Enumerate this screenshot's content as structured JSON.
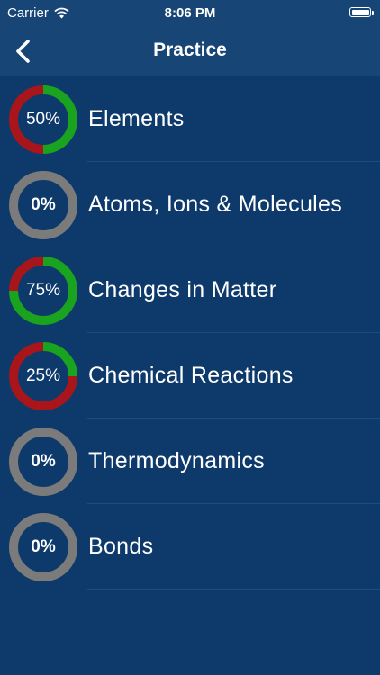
{
  "status_bar": {
    "carrier": "Carrier",
    "time": "8:06 PM"
  },
  "nav": {
    "title": "Practice"
  },
  "colors": {
    "correct": "#1aa31e",
    "incorrect": "#a8161b",
    "empty": "#7b7b7b"
  },
  "topics": [
    {
      "name": "Elements",
      "percent_label": "50%",
      "correct_fraction": 0.5
    },
    {
      "name": "Atoms, Ions & Molecules",
      "percent_label": "0%",
      "correct_fraction": 0
    },
    {
      "name": "Changes in Matter",
      "percent_label": "75%",
      "correct_fraction": 0.75
    },
    {
      "name": "Chemical Reactions",
      "percent_label": "25%",
      "correct_fraction": 0.25
    },
    {
      "name": "Thermodynamics",
      "percent_label": "0%",
      "correct_fraction": 0
    },
    {
      "name": "Bonds",
      "percent_label": "0%",
      "correct_fraction": 0
    }
  ]
}
